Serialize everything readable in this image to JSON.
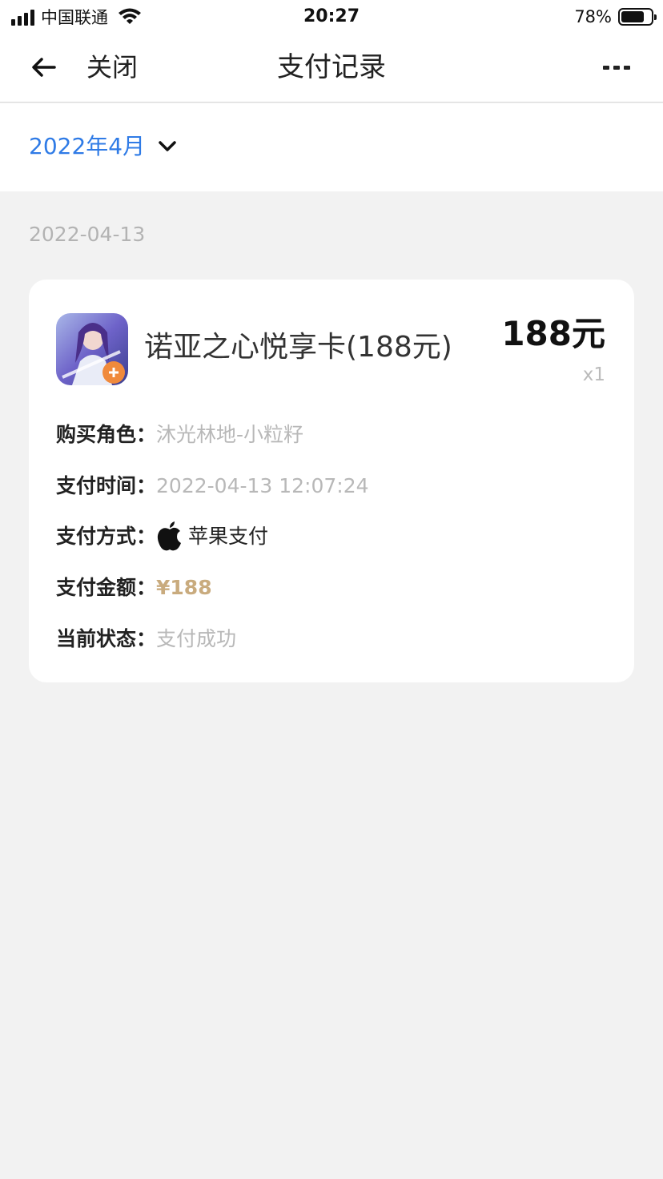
{
  "status_bar": {
    "carrier": "中国联通",
    "time": "20:27",
    "battery_percent": "78%",
    "battery_level": 0.78
  },
  "nav": {
    "close_label": "关闭",
    "title": "支付记录"
  },
  "month_selector": {
    "label": "2022年4月"
  },
  "date_heading": "2022-04-13",
  "record": {
    "product_name": "诺亚之心悦享卡(188元)",
    "price": "188元",
    "quantity": "x1",
    "details": {
      "role_label": "购买角色：",
      "role_value": "沐光林地-小粒籽",
      "time_label": "支付时间：",
      "time_value": "2022-04-13 12:07:24",
      "method_label": "支付方式：",
      "method_value": "苹果支付",
      "amount_label": "支付金额：",
      "amount_value": "¥188",
      "status_label": "当前状态：",
      "status_value": "支付成功"
    }
  },
  "colors": {
    "accent_blue": "#2f7be6",
    "amount_gold": "#c9ab7e",
    "muted_gray": "#b8b8b8",
    "background": "#f2f2f2"
  },
  "icons": [
    "signal-icon",
    "wifi-icon",
    "battery-icon",
    "back-arrow-icon",
    "more-icon",
    "chevron-down-icon",
    "game-app-icon",
    "apple-icon"
  ]
}
